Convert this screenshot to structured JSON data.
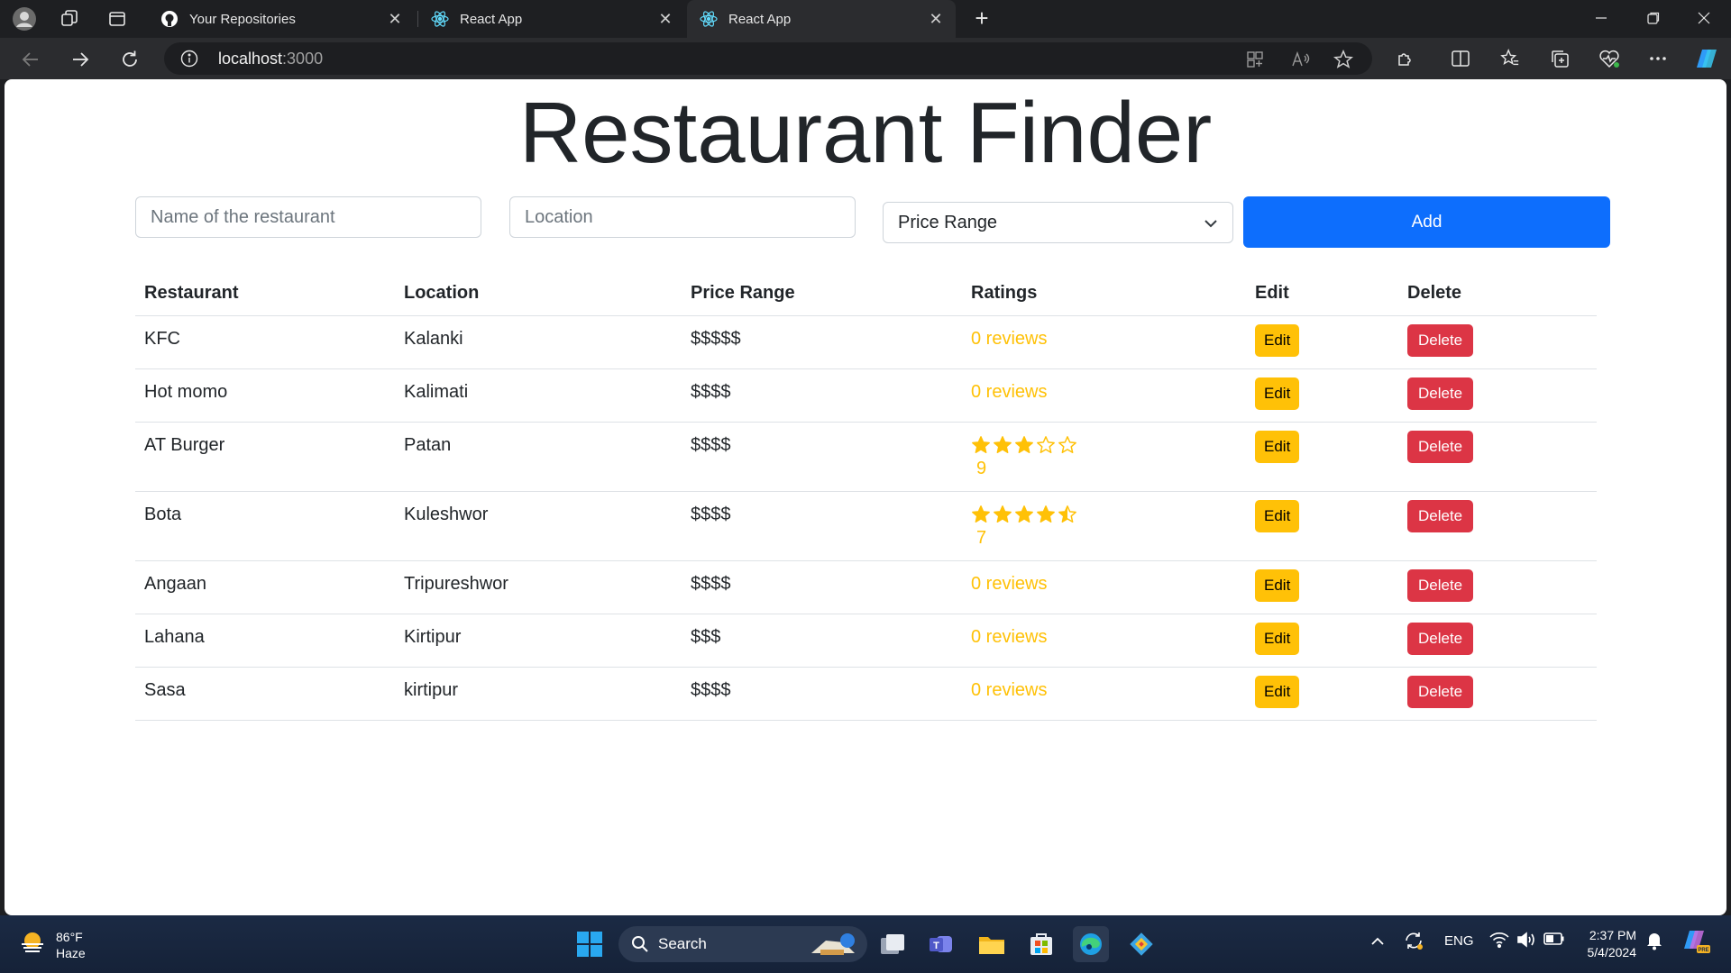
{
  "browser": {
    "tabs": [
      {
        "title": "Your Repositories",
        "icon": "github-icon",
        "active": false
      },
      {
        "title": "React App",
        "icon": "react-icon",
        "active": false
      },
      {
        "title": "React App",
        "icon": "react-icon",
        "active": true
      }
    ],
    "url_host": "localhost",
    "url_port": ":3000"
  },
  "page": {
    "title": "Restaurant Finder",
    "form": {
      "name_placeholder": "Name of the restaurant",
      "location_placeholder": "Location",
      "price_select_value": "Price Range",
      "add_label": "Add"
    },
    "table": {
      "headers": [
        "Restaurant",
        "Location",
        "Price Range",
        "Ratings",
        "Edit",
        "Delete"
      ],
      "rows": [
        {
          "name": "KFC",
          "location": "Kalanki",
          "price": "$$$$$",
          "reviews_text": "0 reviews",
          "edit": "Edit",
          "delete": "Delete"
        },
        {
          "name": "Hot momo",
          "location": "Kalimati",
          "price": "$$$$",
          "reviews_text": "0 reviews",
          "edit": "Edit",
          "delete": "Delete"
        },
        {
          "name": "AT Burger",
          "location": "Patan",
          "price": "$$$$",
          "rating": 3,
          "count": "9",
          "edit": "Edit",
          "delete": "Delete"
        },
        {
          "name": "Bota",
          "location": "Kuleshwor",
          "price": "$$$$",
          "rating": 4.5,
          "count": "7",
          "edit": "Edit",
          "delete": "Delete"
        },
        {
          "name": "Angaan",
          "location": "Tripureshwor",
          "price": "$$$$",
          "reviews_text": "0 reviews",
          "edit": "Edit",
          "delete": "Delete"
        },
        {
          "name": "Lahana",
          "location": "Kirtipur",
          "price": "$$$",
          "reviews_text": "0 reviews",
          "edit": "Edit",
          "delete": "Delete"
        },
        {
          "name": "Sasa",
          "location": "kirtipur",
          "price": "$$$$",
          "reviews_text": "0 reviews",
          "edit": "Edit",
          "delete": "Delete"
        }
      ]
    }
  },
  "taskbar": {
    "weather_temp": "86°F",
    "weather_desc": "Haze",
    "search_label": "Search",
    "language": "ENG",
    "time": "2:37 PM",
    "date": "5/4/2024"
  },
  "colors": {
    "primary": "#0d6efd",
    "warning": "#ffc107",
    "danger": "#dc3545"
  }
}
